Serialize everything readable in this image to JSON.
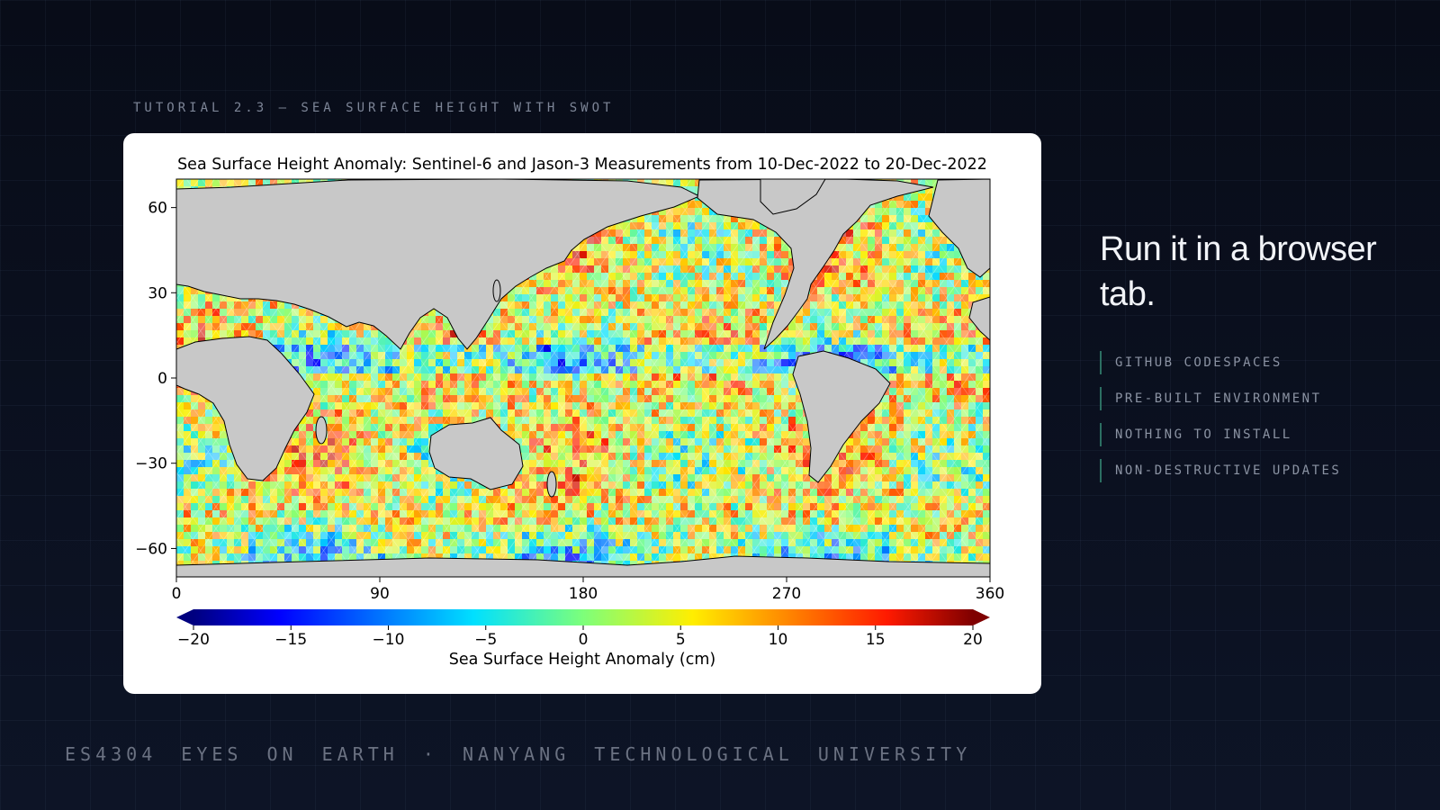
{
  "header": {
    "eyebrow": "TUTORIAL 2.3  —  SEA SURFACE HEIGHT WITH SWOT"
  },
  "figure": {
    "title": "Sea Surface Height Anomaly: Sentinel-6 and Jason-3 Measurements from 10-Dec-2022 to 20-Dec-2022",
    "colorbar_label": "Sea Surface Height Anomaly (cm)"
  },
  "chart_data": {
    "type": "heatmap",
    "title": "Sea Surface Height Anomaly: Sentinel-6 and Jason-3 Measurements from 10-Dec-2022 to 20-Dec-2022",
    "x_ticks": [
      "0",
      "90",
      "180",
      "270",
      "360"
    ],
    "y_ticks": [
      "60",
      "30",
      "0",
      "−30",
      "−60"
    ],
    "xlim": [
      0,
      360
    ],
    "ylim": [
      -70,
      70
    ],
    "colorbar": {
      "label": "Sea Surface Height Anomaly (cm)",
      "range": [
        -20,
        20
      ],
      "ticks": [
        "−20",
        "−15",
        "−10",
        "−5",
        "0",
        "5",
        "10",
        "15",
        "20"
      ],
      "colormap": "jet",
      "extend": "both"
    },
    "land_color": "#c8c8c8"
  },
  "side": {
    "title": "Run it in a browser tab.",
    "items": [
      "GITHUB CODESPACES",
      "PRE-BUILT ENVIRONMENT",
      "NOTHING TO INSTALL",
      "NON-DESTRUCTIVE UPDATES"
    ]
  },
  "footer": {
    "text": "ES4304 EYES ON EARTH · NANYANG TECHNOLOGICAL UNIVERSITY"
  },
  "colors": {
    "accent": "#2c6f62",
    "background": "#0b1020"
  }
}
